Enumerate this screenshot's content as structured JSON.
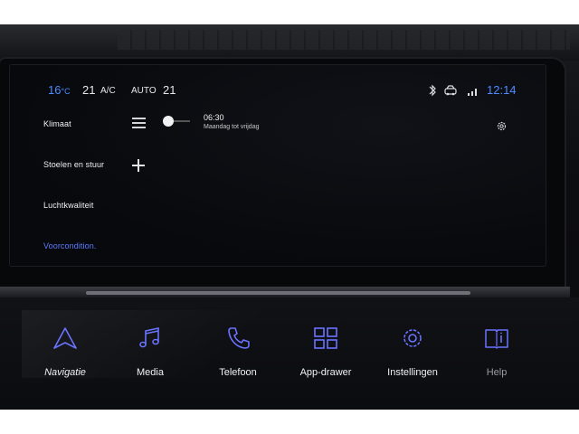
{
  "status": {
    "temp_left": "16",
    "temp_left_unit": "°C",
    "temp_left_2": "21",
    "ac_label": "A/C",
    "auto_label": "AUTO",
    "temp_right": "21",
    "time": "12:14"
  },
  "menu": {
    "items": [
      {
        "label": "Klimaat"
      },
      {
        "label": "Stoelen en stuur"
      },
      {
        "label": "Luchtkwaliteit"
      },
      {
        "label": "Voorcondition."
      }
    ]
  },
  "alarm": {
    "time": "06:30",
    "days": "Maandag tot vrijdag",
    "enabled": false
  },
  "bottom_nav": [
    {
      "label": "Navigatie",
      "icon": "navigation-arrow-icon"
    },
    {
      "label": "Media",
      "icon": "music-note-icon"
    },
    {
      "label": "Telefoon",
      "icon": "phone-icon"
    },
    {
      "label": "App-drawer",
      "icon": "grid-icon"
    },
    {
      "label": "Instellingen",
      "icon": "gear-icon"
    },
    {
      "label": "Help",
      "icon": "help-book-icon"
    }
  ],
  "colors": {
    "accent": "#4d8cff",
    "active_menu": "#5b7cff",
    "icon_purple": "#6a73ff",
    "text": "#f0f0f2"
  }
}
